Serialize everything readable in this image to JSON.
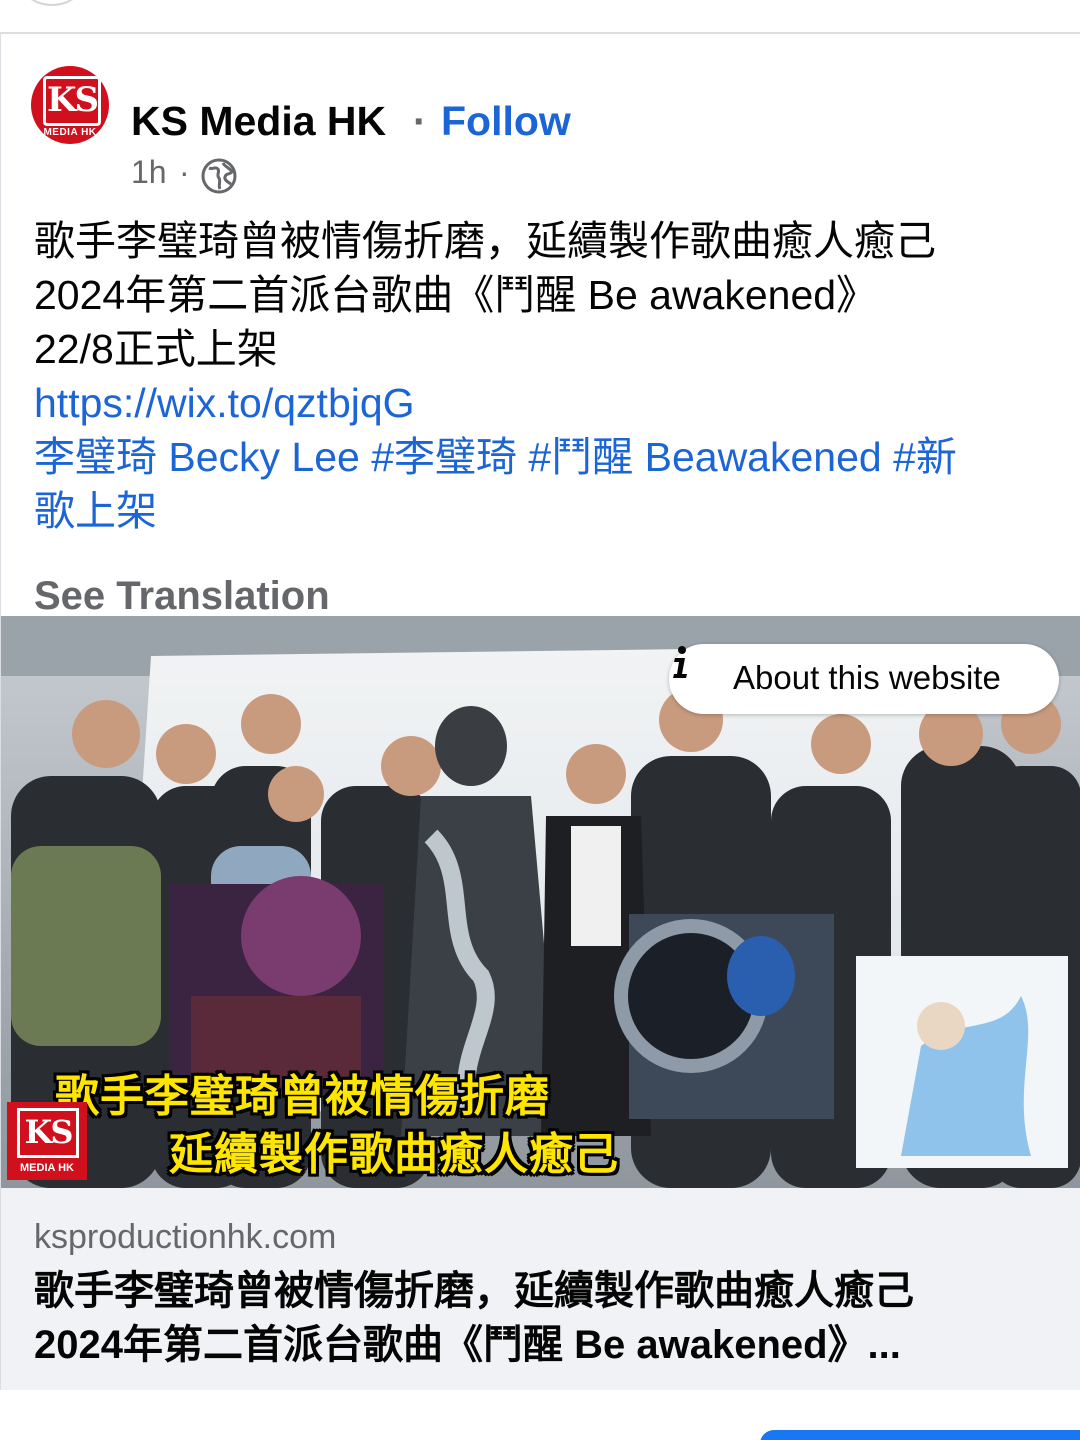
{
  "post": {
    "page_name": "KS Media HK",
    "separator": "·",
    "follow_label": "Follow",
    "time": "1h",
    "meta_separator": "·",
    "privacy_icon": "globe-icon",
    "avatar": {
      "letters": "KS",
      "sub": "MEDIA HK"
    },
    "text_lines": [
      "歌手李璧琦曾被情傷折磨，延續製作歌曲癒人癒己",
      "2024年第二首派台歌曲《鬥醒 Be awakened》",
      "22/8正式上架"
    ],
    "link": "https://wix.to/qztbjqG",
    "tags_line_1": "李璧琦 Becky Lee #李璧琦 #鬥醒 Beawakened #新",
    "tags_line_2": "歌上架",
    "see_translation": "See Translation"
  },
  "media": {
    "about_label": "About this website",
    "info_icon": "info-icon",
    "overlay_line_1": "歌手李璧琦曾被情傷折磨",
    "overlay_line_2": "延續製作歌曲癒人癒己",
    "watermark": {
      "letters": "KS",
      "sub": "MEDIA HK"
    }
  },
  "link_preview": {
    "domain": "ksproductionhk.com",
    "title_line_1": "歌手李璧琦曾被情傷折磨，延續製作歌曲癒人癒己",
    "title_line_2": "2024年第二首派台歌曲《鬥醒 Be awakened》..."
  },
  "colors": {
    "link": "#1c65d6",
    "secondary_text": "#65676b",
    "brand_red": "#d0101d",
    "overlay_yellow": "#ffe600",
    "preview_bg": "#f0f2f5"
  }
}
